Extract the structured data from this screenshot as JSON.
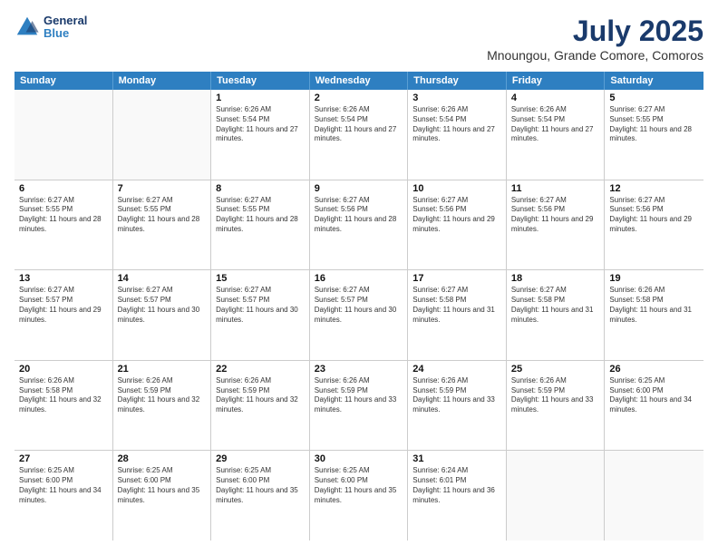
{
  "logo": {
    "line1": "General",
    "line2": "Blue"
  },
  "title": "July 2025",
  "subtitle": "Mnoungou, Grande Comore, Comoros",
  "days": [
    "Sunday",
    "Monday",
    "Tuesday",
    "Wednesday",
    "Thursday",
    "Friday",
    "Saturday"
  ],
  "weeks": [
    [
      {
        "day": "",
        "info": ""
      },
      {
        "day": "",
        "info": ""
      },
      {
        "day": "1",
        "info": "Sunrise: 6:26 AM\nSunset: 5:54 PM\nDaylight: 11 hours and 27 minutes."
      },
      {
        "day": "2",
        "info": "Sunrise: 6:26 AM\nSunset: 5:54 PM\nDaylight: 11 hours and 27 minutes."
      },
      {
        "day": "3",
        "info": "Sunrise: 6:26 AM\nSunset: 5:54 PM\nDaylight: 11 hours and 27 minutes."
      },
      {
        "day": "4",
        "info": "Sunrise: 6:26 AM\nSunset: 5:54 PM\nDaylight: 11 hours and 27 minutes."
      },
      {
        "day": "5",
        "info": "Sunrise: 6:27 AM\nSunset: 5:55 PM\nDaylight: 11 hours and 28 minutes."
      }
    ],
    [
      {
        "day": "6",
        "info": "Sunrise: 6:27 AM\nSunset: 5:55 PM\nDaylight: 11 hours and 28 minutes."
      },
      {
        "day": "7",
        "info": "Sunrise: 6:27 AM\nSunset: 5:55 PM\nDaylight: 11 hours and 28 minutes."
      },
      {
        "day": "8",
        "info": "Sunrise: 6:27 AM\nSunset: 5:55 PM\nDaylight: 11 hours and 28 minutes."
      },
      {
        "day": "9",
        "info": "Sunrise: 6:27 AM\nSunset: 5:56 PM\nDaylight: 11 hours and 28 minutes."
      },
      {
        "day": "10",
        "info": "Sunrise: 6:27 AM\nSunset: 5:56 PM\nDaylight: 11 hours and 29 minutes."
      },
      {
        "day": "11",
        "info": "Sunrise: 6:27 AM\nSunset: 5:56 PM\nDaylight: 11 hours and 29 minutes."
      },
      {
        "day": "12",
        "info": "Sunrise: 6:27 AM\nSunset: 5:56 PM\nDaylight: 11 hours and 29 minutes."
      }
    ],
    [
      {
        "day": "13",
        "info": "Sunrise: 6:27 AM\nSunset: 5:57 PM\nDaylight: 11 hours and 29 minutes."
      },
      {
        "day": "14",
        "info": "Sunrise: 6:27 AM\nSunset: 5:57 PM\nDaylight: 11 hours and 30 minutes."
      },
      {
        "day": "15",
        "info": "Sunrise: 6:27 AM\nSunset: 5:57 PM\nDaylight: 11 hours and 30 minutes."
      },
      {
        "day": "16",
        "info": "Sunrise: 6:27 AM\nSunset: 5:57 PM\nDaylight: 11 hours and 30 minutes."
      },
      {
        "day": "17",
        "info": "Sunrise: 6:27 AM\nSunset: 5:58 PM\nDaylight: 11 hours and 31 minutes."
      },
      {
        "day": "18",
        "info": "Sunrise: 6:27 AM\nSunset: 5:58 PM\nDaylight: 11 hours and 31 minutes."
      },
      {
        "day": "19",
        "info": "Sunrise: 6:26 AM\nSunset: 5:58 PM\nDaylight: 11 hours and 31 minutes."
      }
    ],
    [
      {
        "day": "20",
        "info": "Sunrise: 6:26 AM\nSunset: 5:58 PM\nDaylight: 11 hours and 32 minutes."
      },
      {
        "day": "21",
        "info": "Sunrise: 6:26 AM\nSunset: 5:59 PM\nDaylight: 11 hours and 32 minutes."
      },
      {
        "day": "22",
        "info": "Sunrise: 6:26 AM\nSunset: 5:59 PM\nDaylight: 11 hours and 32 minutes."
      },
      {
        "day": "23",
        "info": "Sunrise: 6:26 AM\nSunset: 5:59 PM\nDaylight: 11 hours and 33 minutes."
      },
      {
        "day": "24",
        "info": "Sunrise: 6:26 AM\nSunset: 5:59 PM\nDaylight: 11 hours and 33 minutes."
      },
      {
        "day": "25",
        "info": "Sunrise: 6:26 AM\nSunset: 5:59 PM\nDaylight: 11 hours and 33 minutes."
      },
      {
        "day": "26",
        "info": "Sunrise: 6:25 AM\nSunset: 6:00 PM\nDaylight: 11 hours and 34 minutes."
      }
    ],
    [
      {
        "day": "27",
        "info": "Sunrise: 6:25 AM\nSunset: 6:00 PM\nDaylight: 11 hours and 34 minutes."
      },
      {
        "day": "28",
        "info": "Sunrise: 6:25 AM\nSunset: 6:00 PM\nDaylight: 11 hours and 35 minutes."
      },
      {
        "day": "29",
        "info": "Sunrise: 6:25 AM\nSunset: 6:00 PM\nDaylight: 11 hours and 35 minutes."
      },
      {
        "day": "30",
        "info": "Sunrise: 6:25 AM\nSunset: 6:00 PM\nDaylight: 11 hours and 35 minutes."
      },
      {
        "day": "31",
        "info": "Sunrise: 6:24 AM\nSunset: 6:01 PM\nDaylight: 11 hours and 36 minutes."
      },
      {
        "day": "",
        "info": ""
      },
      {
        "day": "",
        "info": ""
      }
    ]
  ]
}
